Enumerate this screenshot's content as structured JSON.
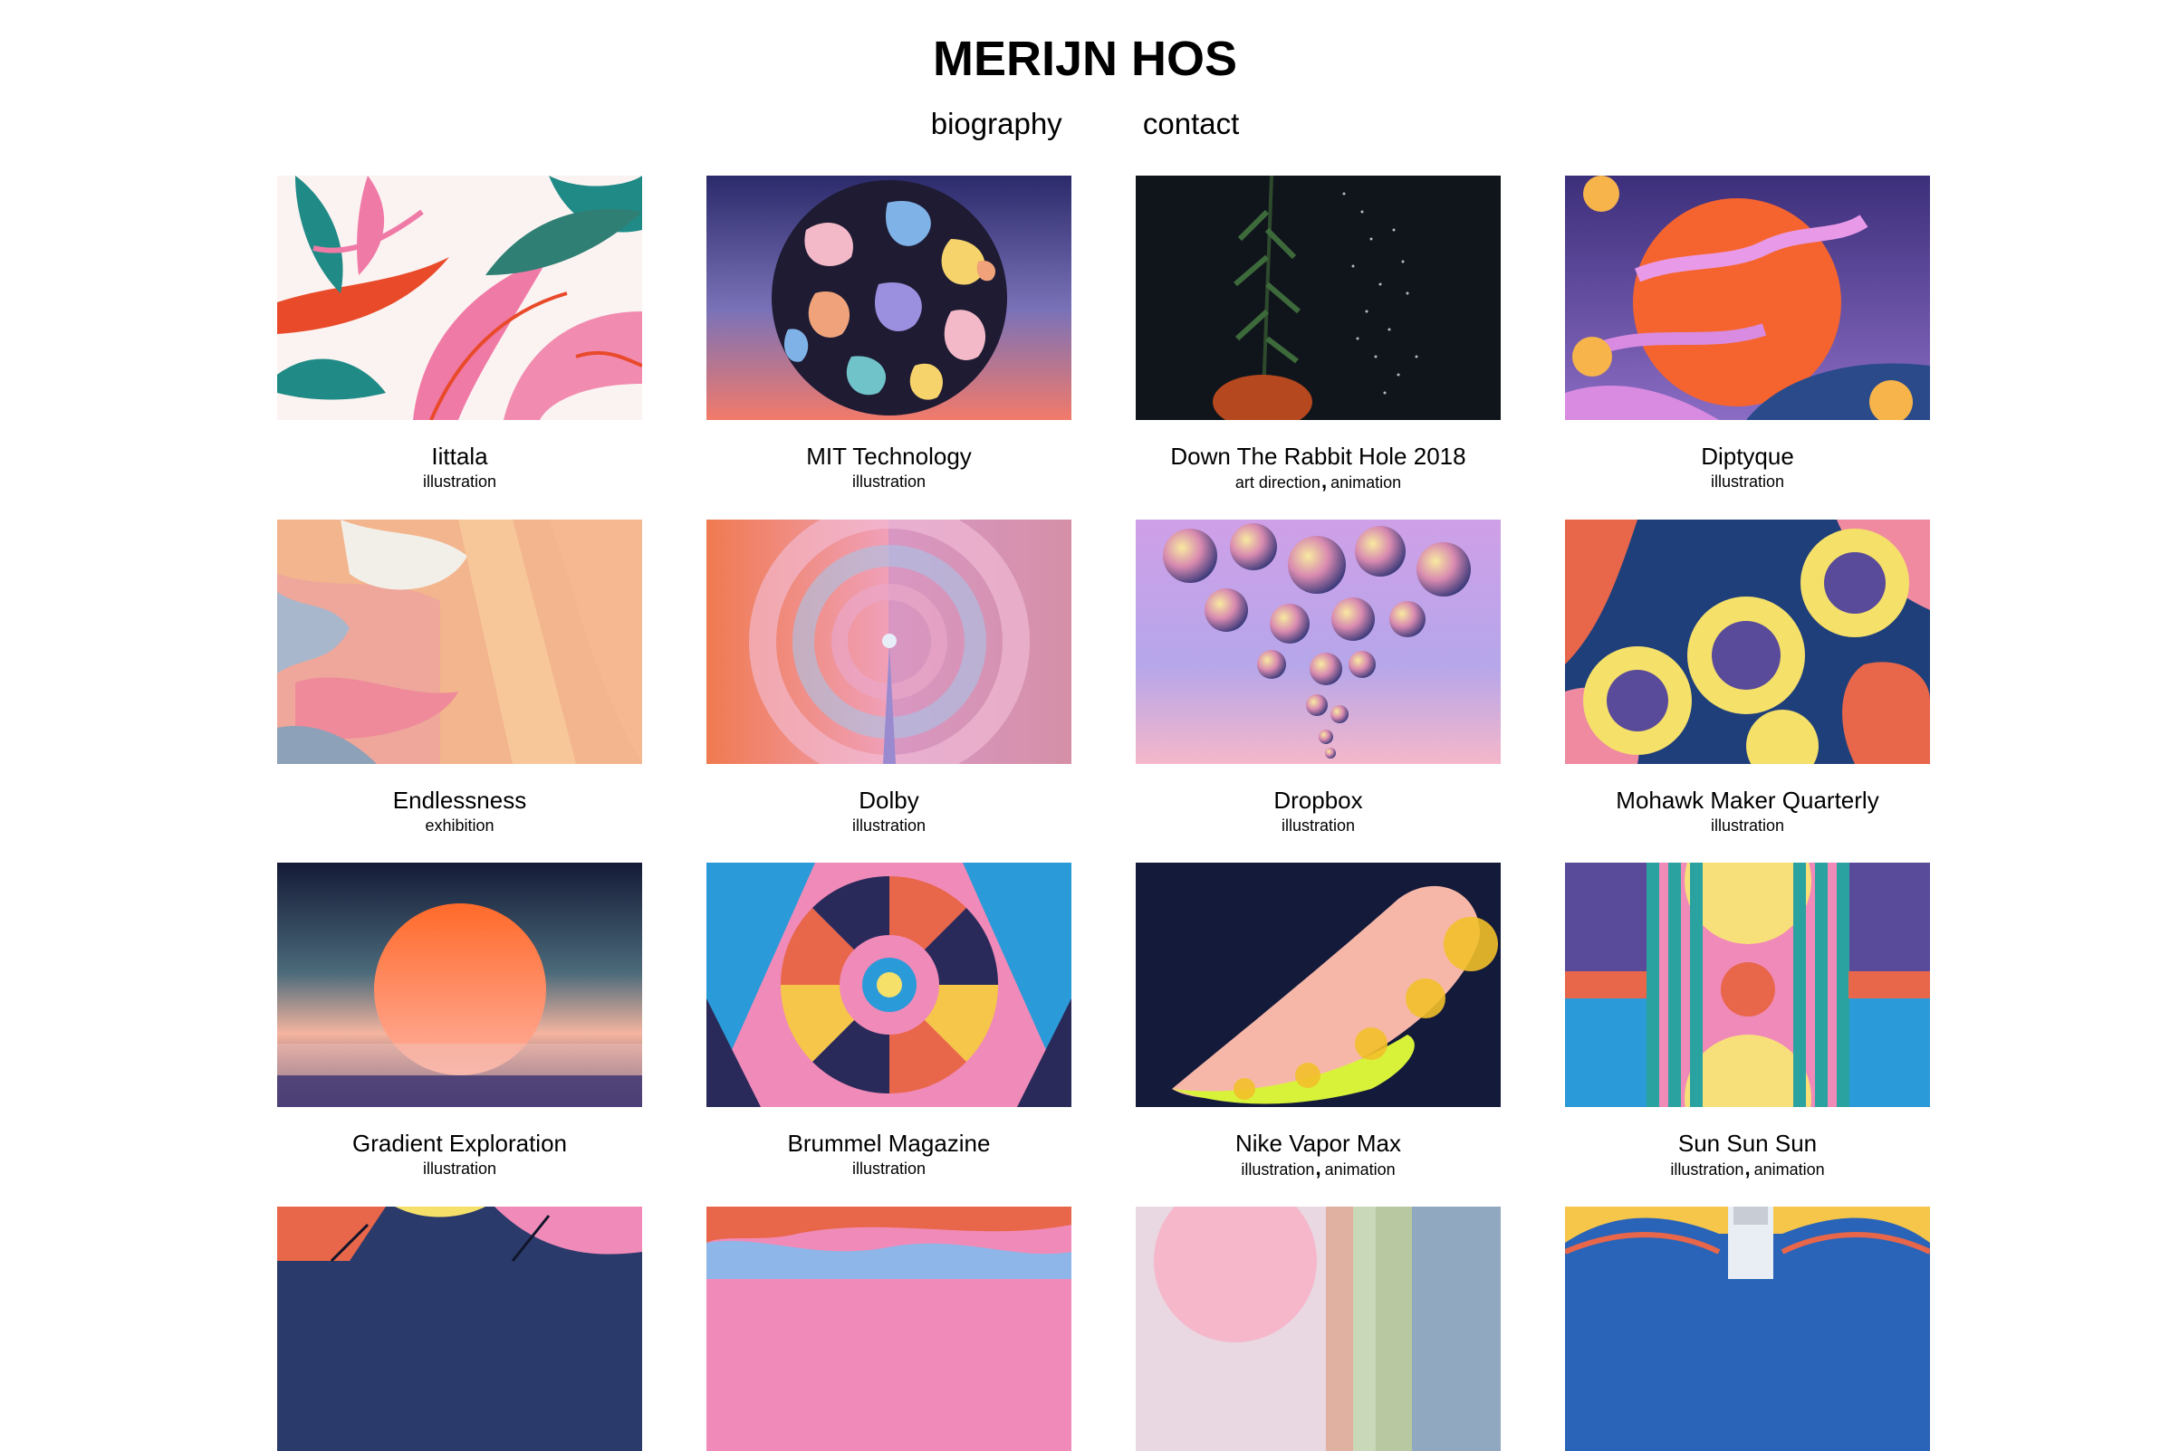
{
  "site": {
    "title": "MERIJN HOS"
  },
  "nav": {
    "items": [
      "biography",
      "contact"
    ]
  },
  "projects": [
    {
      "title": "Iittala",
      "tags": [
        "illustration"
      ],
      "thumb": "floral-pink-teal"
    },
    {
      "title": "MIT Technology",
      "tags": [
        "illustration"
      ],
      "thumb": "camo-sphere"
    },
    {
      "title": "Down The Rabbit Hole 2018",
      "tags": [
        "art direction",
        "animation"
      ],
      "thumb": "dark-plant-sparkles"
    },
    {
      "title": "Diptyque",
      "tags": [
        "illustration"
      ],
      "thumb": "orange-sun-clouds"
    },
    {
      "title": "Endlessness",
      "tags": [
        "exhibition"
      ],
      "thumb": "dyed-fabric"
    },
    {
      "title": "Dolby",
      "tags": [
        "illustration"
      ],
      "thumb": "concentric-arcs"
    },
    {
      "title": "Dropbox",
      "tags": [
        "illustration"
      ],
      "thumb": "floating-spheres"
    },
    {
      "title": "Mohawk Maker Quarterly",
      "tags": [
        "illustration"
      ],
      "thumb": "yellow-swirls"
    },
    {
      "title": "Gradient Exploration",
      "tags": [
        "illustration"
      ],
      "thumb": "gradient-sunset"
    },
    {
      "title": "Brummel Magazine",
      "tags": [
        "illustration"
      ],
      "thumb": "geometric-rosette"
    },
    {
      "title": "Nike Vapor Max",
      "tags": [
        "illustration",
        "animation"
      ],
      "thumb": "pink-sneaker"
    },
    {
      "title": "Sun Sun Sun",
      "tags": [
        "illustration",
        "animation"
      ],
      "thumb": "geometric-suns"
    },
    {
      "title": "",
      "tags": [],
      "thumb": "partial-abstract-dark"
    },
    {
      "title": "",
      "tags": [],
      "thumb": "partial-pink-waves"
    },
    {
      "title": "",
      "tags": [],
      "thumb": "partial-pastel-stripes"
    },
    {
      "title": "",
      "tags": [],
      "thumb": "partial-blue-bottle"
    }
  ]
}
